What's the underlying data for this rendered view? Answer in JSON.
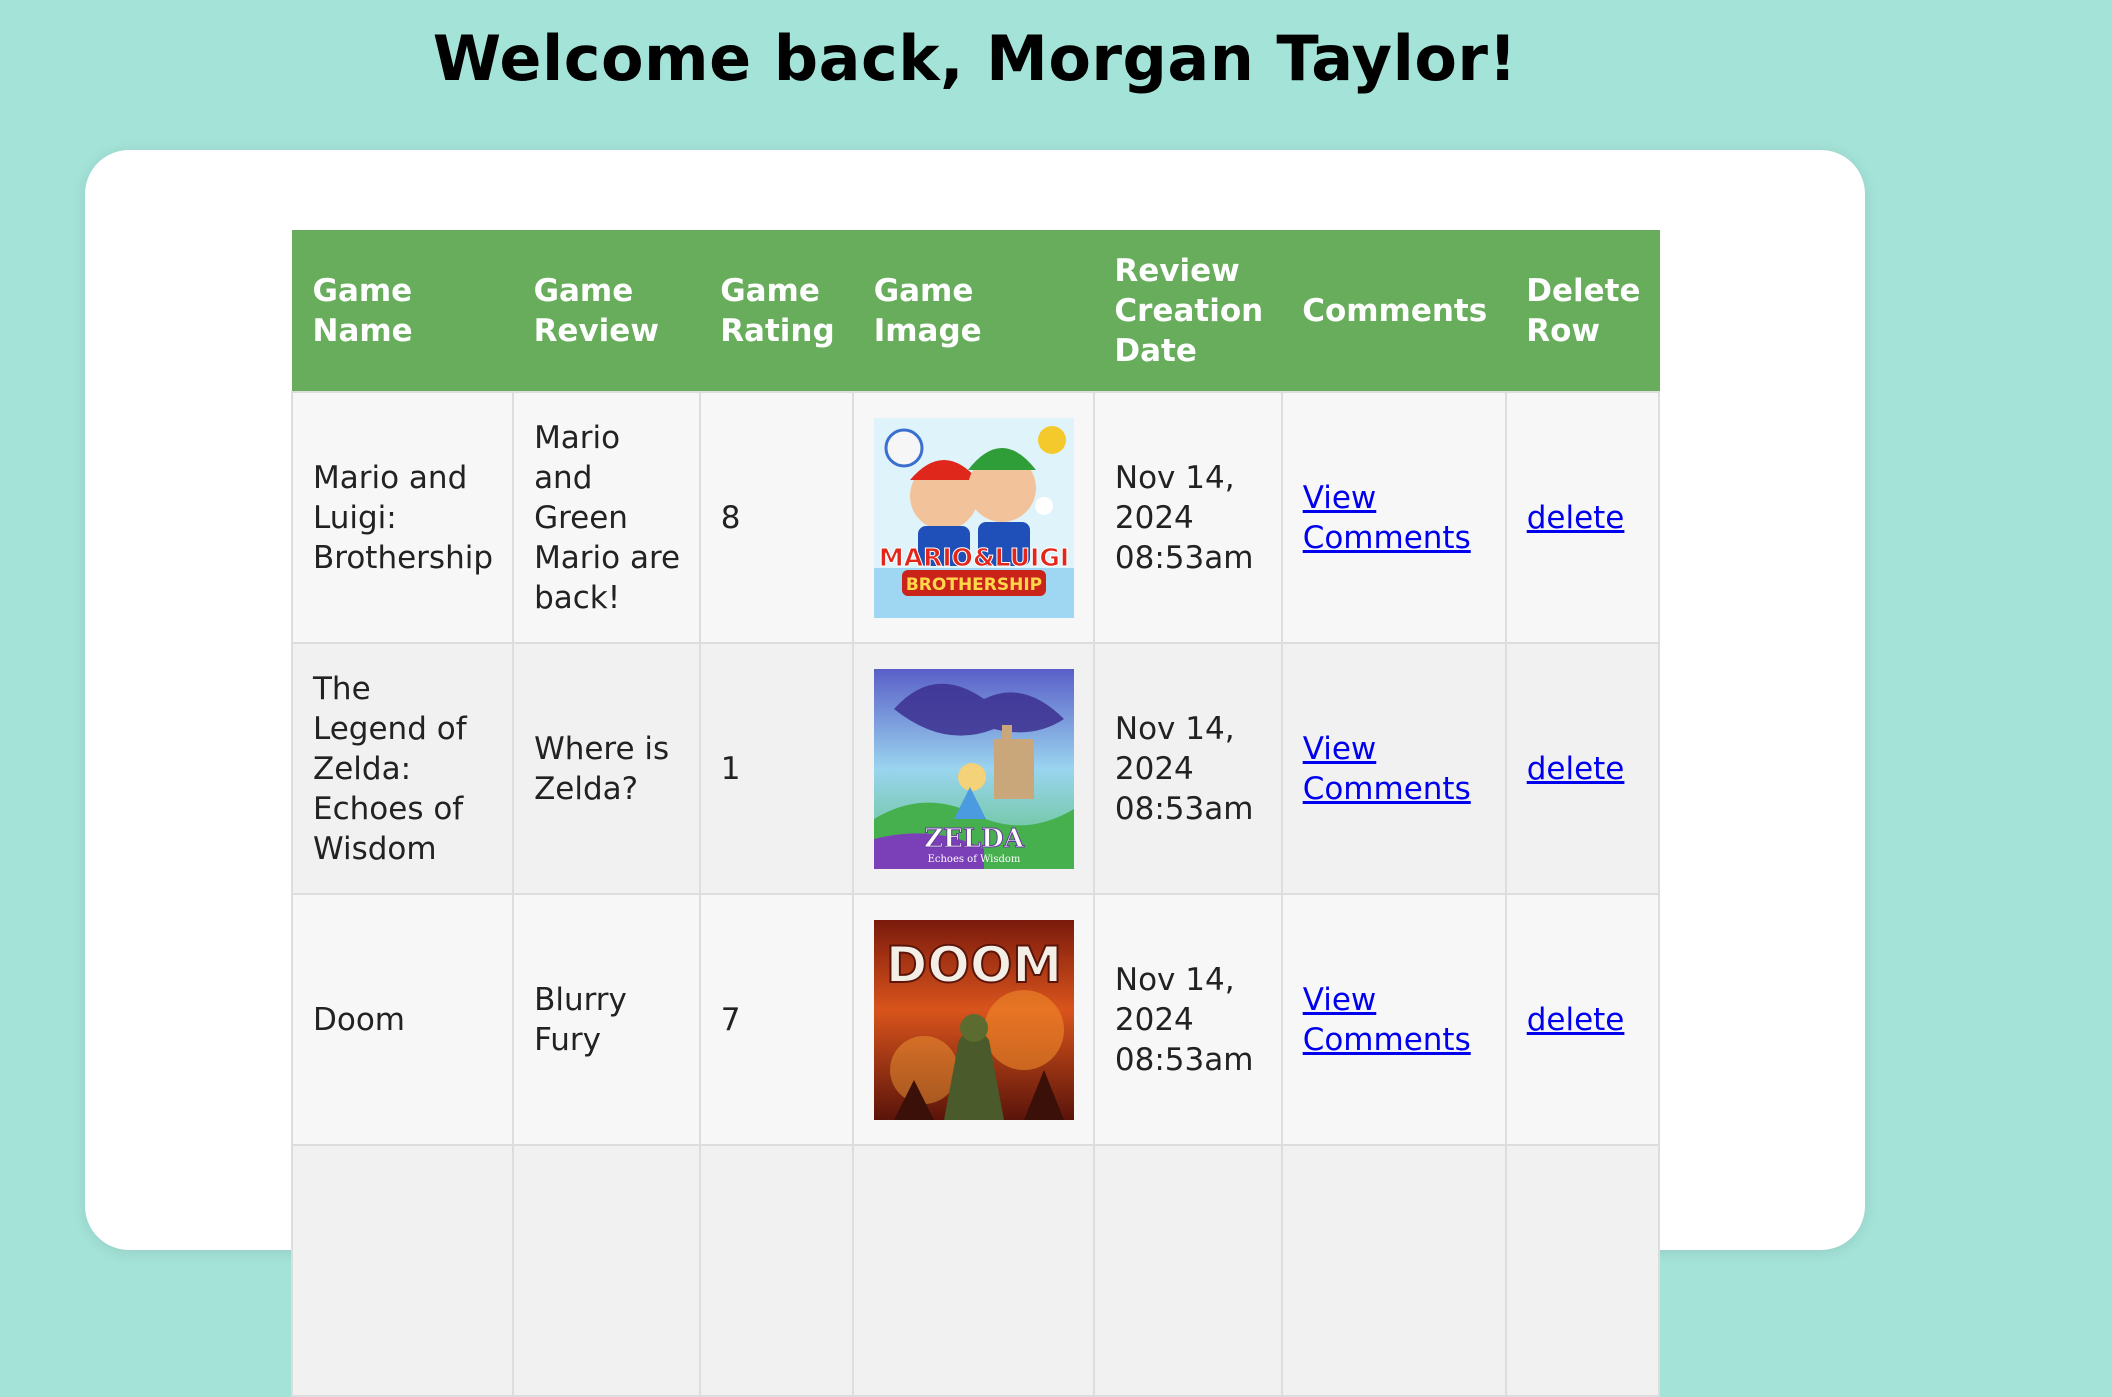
{
  "page": {
    "welcome_text": "Welcome back, Morgan Taylor!"
  },
  "table": {
    "headers": [
      "Game Name",
      "Game Review",
      "Game Rating",
      "Game Image",
      "Review Creation Date",
      "Comments",
      "Delete Row"
    ],
    "rows": [
      {
        "name": "Mario and Luigi: Brothership",
        "review": "Mario and Green Mario are back!",
        "rating": "8",
        "image_label": "Mario & Luigi Brothership cover art",
        "image_title_text": "MARIO&LUIGI",
        "image_subtitle_text": "BROTHERSHIP",
        "date": "Nov 14, 2024 08:53am",
        "comments_link": "View Comments",
        "delete_link": "delete"
      },
      {
        "name": "The Legend of Zelda: Echoes of Wisdom",
        "review": "Where is Zelda?",
        "rating": "1",
        "image_label": "The Legend of Zelda: Echoes of Wisdom cover art",
        "image_title_text": "ZELDA",
        "image_subtitle_text": "Echoes of Wisdom",
        "date": "Nov 14, 2024 08:53am",
        "comments_link": "View Comments",
        "delete_link": "delete"
      },
      {
        "name": "Doom",
        "review": "Blurry Fury",
        "rating": "7",
        "image_label": "Doom cover art",
        "image_title_text": "DOOM",
        "date": "Nov 14, 2024 08:53am",
        "comments_link": "View Comments",
        "delete_link": "delete"
      }
    ]
  },
  "colors": {
    "page_background": "#a4e3d8",
    "header_background": "#68ad5c",
    "link": "#0000ee"
  }
}
